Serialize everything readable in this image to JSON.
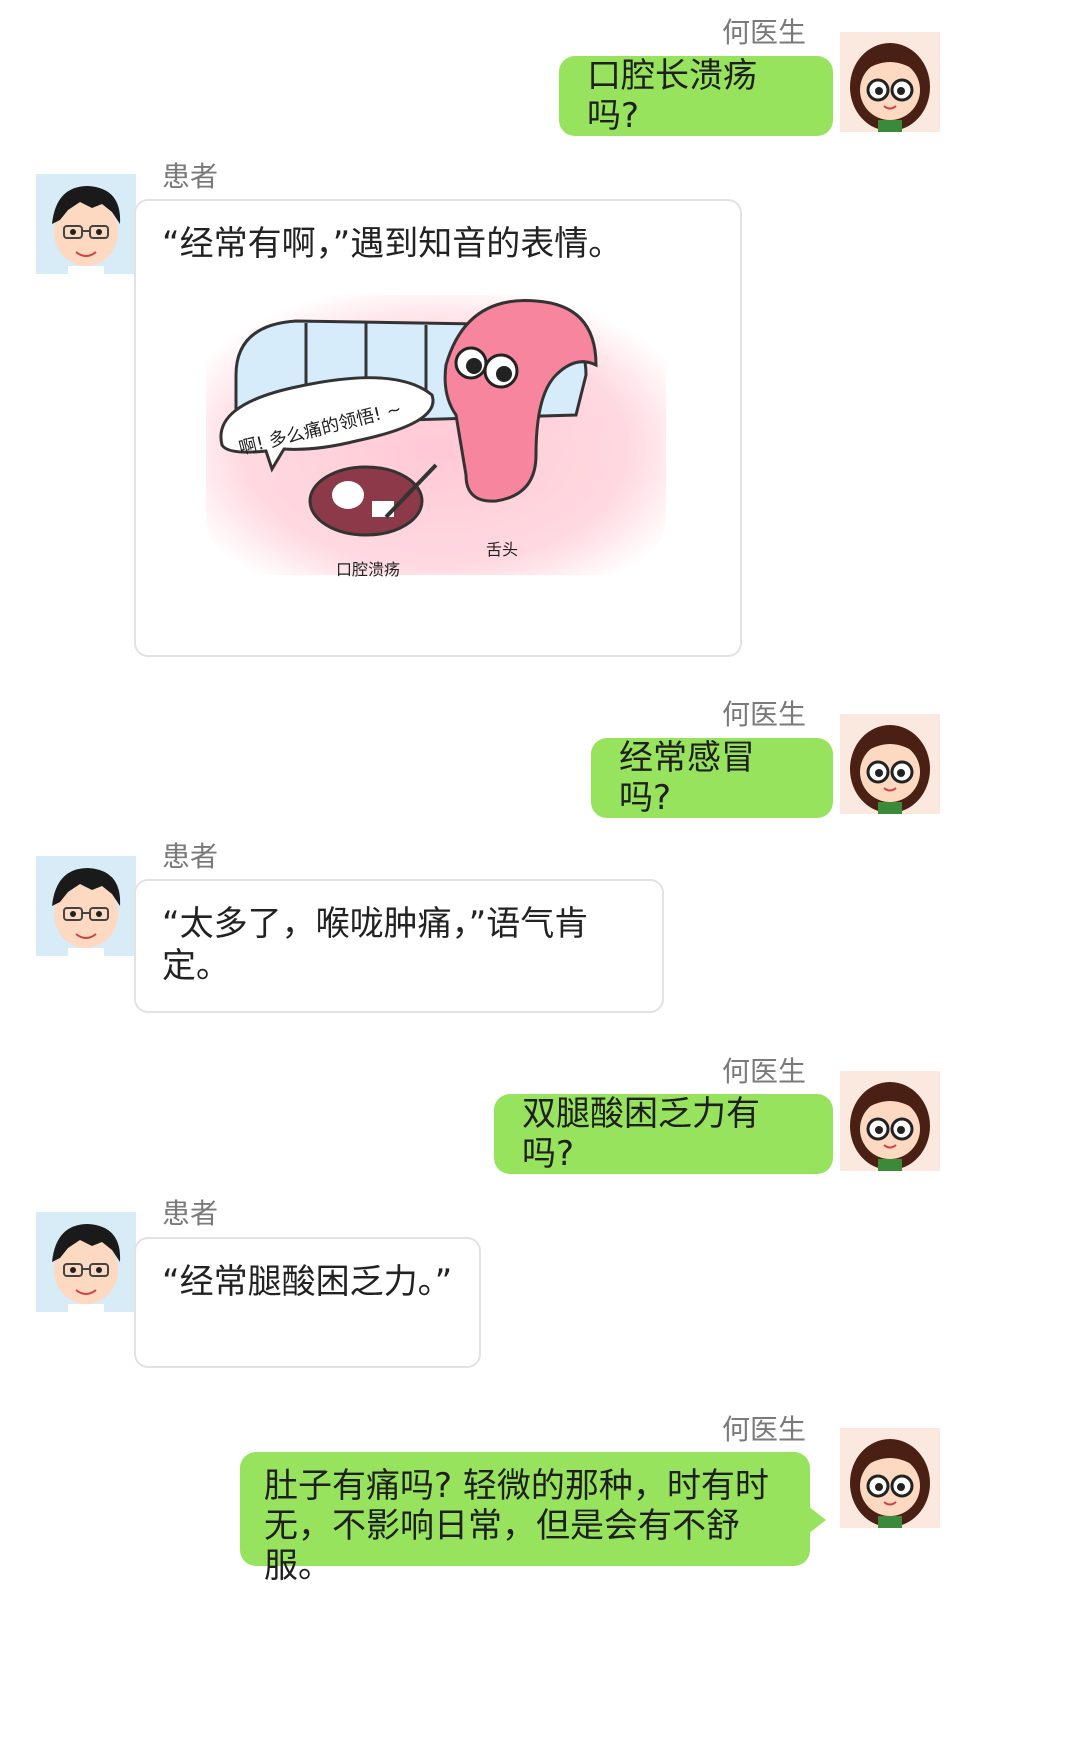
{
  "doctor_name": "何医生",
  "patient_name": "患者",
  "messages": [
    {
      "sender": "doctor",
      "text": "口腔长溃疡吗?"
    },
    {
      "sender": "patient",
      "text": "“经常有啊，”遇到知音的表情。",
      "illustration": {
        "speech": "啊! 多么痛的领悟! ~",
        "label_ulcer": "口腔溃疡",
        "label_tongue": "舌头"
      }
    },
    {
      "sender": "doctor",
      "text": "经常感冒吗?"
    },
    {
      "sender": "patient",
      "text": "“太多了，喉咙肿痛，”语气肯定。"
    },
    {
      "sender": "doctor",
      "text": "双腿酸困乏力有吗?"
    },
    {
      "sender": "patient",
      "text": "“经常腿酸困乏力。”"
    },
    {
      "sender": "doctor",
      "text": "肚子有痛吗? 轻微的那种，时有时无，不影响日常，但是会有不舒服。"
    }
  ],
  "colors": {
    "doctor_bubble": "#97e35e",
    "patient_bubble_border": "#e2e2e2",
    "name_text": "#7a7a7a"
  }
}
